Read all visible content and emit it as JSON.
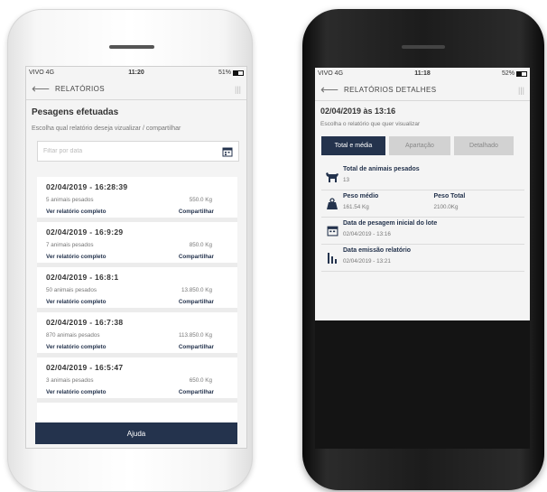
{
  "phone_left": {
    "status_bar": {
      "carrier": "VIVO  4G",
      "time": "11:20",
      "battery": "51%"
    },
    "header": {
      "back_icon": "arrow-left-icon",
      "title": "RELATÓRIOS",
      "menu_icon": "menu-icon"
    },
    "page_title": "Pesagens efetuadas",
    "subtitle": "Escolha qual relatório deseja vizualizar / compartilhar",
    "filter": {
      "placeholder": "Filtar por data",
      "icon": "calendar-icon"
    },
    "reports": [
      {
        "datetime": "02/04/2019  -  16:28:39",
        "animals": "5 animais pesados",
        "weight": "550.0 Kg",
        "view": "Ver relatório completo",
        "share": "Compartilhar"
      },
      {
        "datetime": "02/04/2019  -  16:9:29",
        "animals": "7 animais pesados",
        "weight": "850.0 Kg",
        "view": "Ver relatório completo",
        "share": "Compartilhar"
      },
      {
        "datetime": "02/04/2019  -  16:8:1",
        "animals": "50 animais pesados",
        "weight": "13.850.0 Kg",
        "view": "Ver relatório completo",
        "share": "Compartilhar"
      },
      {
        "datetime": "02/04/2019  -  16:7:38",
        "animals": "870 animais pesados",
        "weight": "113.850.0 Kg",
        "view": "Ver relatório completo",
        "share": "Compartilhar"
      },
      {
        "datetime": "02/04/2019  -  16:5:47",
        "animals": "3 animais pesados",
        "weight": "650.0 Kg",
        "view": "Ver relatório completo",
        "share": "Compartilhar"
      }
    ],
    "help_button": "Ajuda"
  },
  "phone_right": {
    "status_bar": {
      "carrier": "VIVO  4G",
      "time": "11:18",
      "battery": "52%"
    },
    "header": {
      "back_icon": "arrow-left-icon",
      "title": "RELATÓRIOS DETALHES",
      "menu_icon": "menu-icon"
    },
    "page_title": "02/04/2019  às  13:16",
    "subtitle": "Escolha o relatório que quer visualizar",
    "tabs": [
      {
        "label": "Total e média",
        "active": true
      },
      {
        "label": "Apartação",
        "active": false
      },
      {
        "label": "Detalhado",
        "active": false
      }
    ],
    "details": {
      "total_animals": {
        "label": "Total de animais pesados",
        "value": "13",
        "icon": "cow-icon"
      },
      "avg_weight": {
        "label": "Peso médio",
        "value": "161.54 Kg",
        "icon": "weight-icon"
      },
      "total_weight": {
        "label": "Peso Total",
        "value": "2100.0Kg"
      },
      "start_date": {
        "label": "Data de pesagem inicial do lote",
        "value": "02/04/2019  -  13:16",
        "icon": "calendar-icon"
      },
      "emission_date": {
        "label": "Data emissão relatório",
        "value": "02/04/2019  -  13:21",
        "icon": "bars-icon"
      }
    }
  },
  "colors": {
    "primary": "#24334d",
    "background": "#f4f4f4",
    "inactive_tab": "#d2d2d2"
  }
}
